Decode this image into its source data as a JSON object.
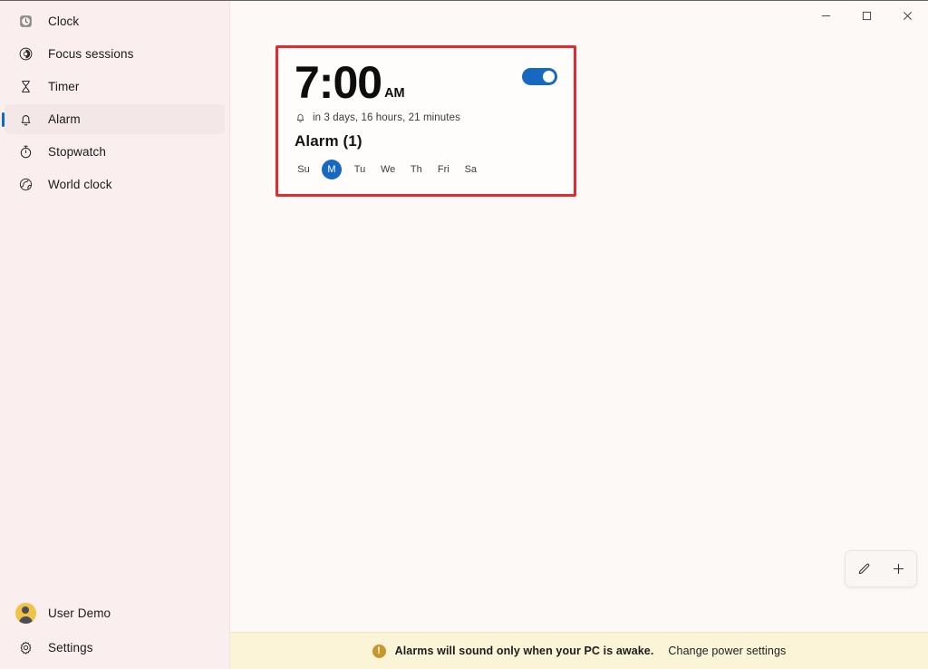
{
  "window": {
    "controls": {
      "minimize": "minimize-button",
      "maximize": "maximize-button",
      "close": "close-button"
    }
  },
  "sidebar": {
    "items": [
      {
        "label": "Clock",
        "icon": "clock-icon",
        "selected": false
      },
      {
        "label": "Focus sessions",
        "icon": "focus-icon",
        "selected": false
      },
      {
        "label": "Timer",
        "icon": "hourglass-icon",
        "selected": false
      },
      {
        "label": "Alarm",
        "icon": "bell-icon",
        "selected": true
      },
      {
        "label": "Stopwatch",
        "icon": "stopwatch-icon",
        "selected": false
      },
      {
        "label": "World clock",
        "icon": "globe-icon",
        "selected": false
      }
    ],
    "bottom": [
      {
        "label": "User Demo",
        "icon": "avatar-icon"
      },
      {
        "label": "Settings",
        "icon": "gear-icon"
      }
    ]
  },
  "alarm_card": {
    "time": "7:00",
    "meridiem": "AM",
    "toggle_on": true,
    "next_ring": "in 3 days, 16 hours, 21 minutes",
    "name": "Alarm (1)",
    "days": [
      {
        "label": "Su",
        "active": false
      },
      {
        "label": "M",
        "active": true
      },
      {
        "label": "Tu",
        "active": false
      },
      {
        "label": "We",
        "active": false
      },
      {
        "label": "Th",
        "active": false
      },
      {
        "label": "Fri",
        "active": false
      },
      {
        "label": "Sa",
        "active": false
      }
    ],
    "highlight_color": "#e12b30"
  },
  "actions": {
    "edit": "edit-alarm-button",
    "add": "add-alarm-button"
  },
  "warning": {
    "message": "Alarms will sound only when your PC is awake.",
    "link": "Change power settings",
    "icon_glyph": "!",
    "background": "#fcf4d6"
  },
  "colors": {
    "accent": "#1668c1",
    "sidebar_bg": "#faeeee",
    "content_bg": "#fdf9f6"
  }
}
